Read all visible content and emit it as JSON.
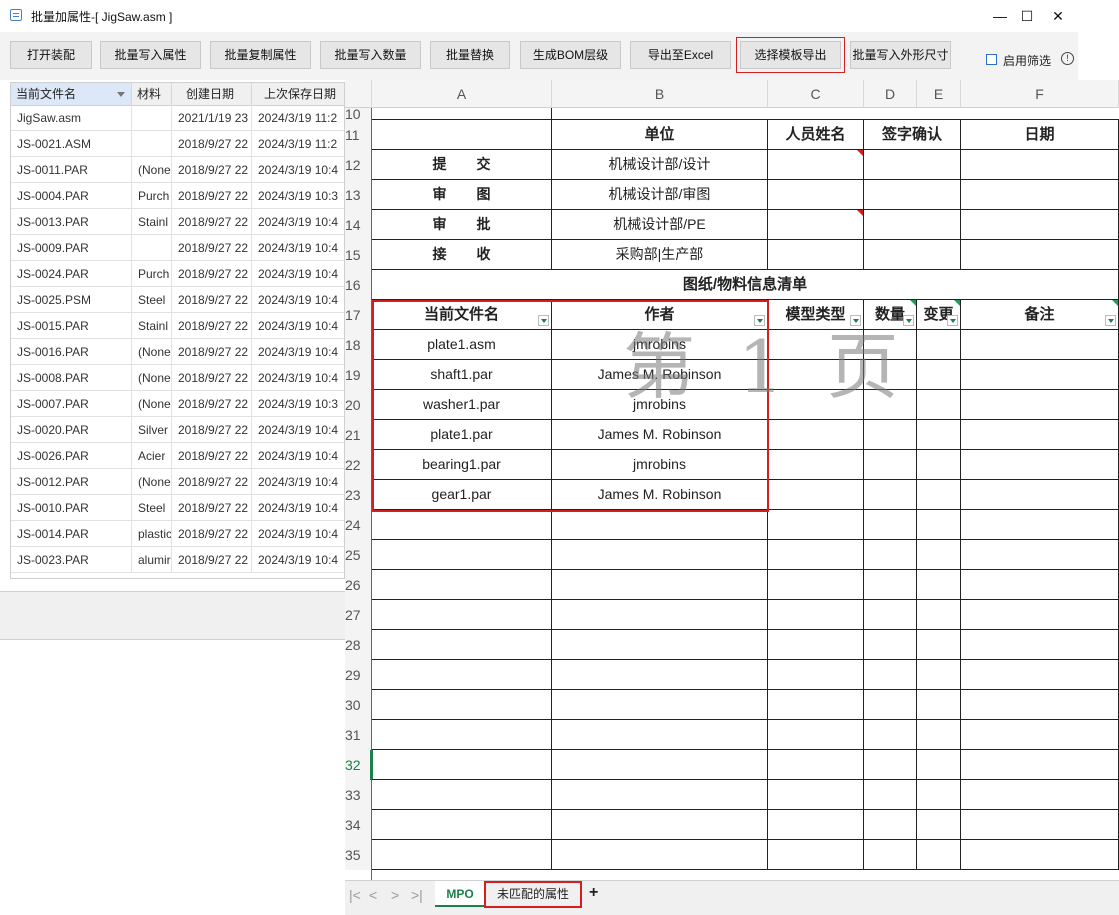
{
  "window": {
    "title": "批量加属性-[ JigSaw.asm ]",
    "minimize": "—",
    "maximize": "☐",
    "close": "✕"
  },
  "toolbar": {
    "buttons": [
      "打开装配",
      "批量写入属性",
      "批量复制属性",
      "批量写入数量",
      "批量替换",
      "生成BOM层级",
      "导出至Excel",
      "选择模板导出",
      "批量写入外形尺寸"
    ],
    "filter_label": "启用筛选",
    "info_icon": "!"
  },
  "file_list": {
    "columns": [
      "当前文件名",
      "材料",
      "创建日期",
      "上次保存日期"
    ],
    "rows": [
      [
        "JigSaw.asm",
        "",
        "2021/1/19 23",
        "2024/3/19 11:2"
      ],
      [
        "JS-0021.ASM",
        "",
        "2018/9/27 22",
        "2024/3/19 11:2"
      ],
      [
        "JS-0011.PAR",
        "(None",
        "2018/9/27 22",
        "2024/3/19 10:4"
      ],
      [
        "JS-0004.PAR",
        "Purch",
        "2018/9/27 22",
        "2024/3/19 10:3"
      ],
      [
        "JS-0013.PAR",
        "Stainl",
        "2018/9/27 22",
        "2024/3/19 10:4"
      ],
      [
        "JS-0009.PAR",
        "",
        "2018/9/27 22",
        "2024/3/19 10:4"
      ],
      [
        "JS-0024.PAR",
        "Purch",
        "2018/9/27 22",
        "2024/3/19 10:4"
      ],
      [
        "JS-0025.PSM",
        "Steel",
        "2018/9/27 22",
        "2024/3/19 10:4"
      ],
      [
        "JS-0015.PAR",
        "Stainl",
        "2018/9/27 22",
        "2024/3/19 10:4"
      ],
      [
        "JS-0016.PAR",
        "(None",
        "2018/9/27 22",
        "2024/3/19 10:4"
      ],
      [
        "JS-0008.PAR",
        "(None",
        "2018/9/27 22",
        "2024/3/19 10:4"
      ],
      [
        "JS-0007.PAR",
        "(None",
        "2018/9/27 22",
        "2024/3/19 10:3"
      ],
      [
        "JS-0020.PAR",
        "Silver",
        "2018/9/27 22",
        "2024/3/19 10:4"
      ],
      [
        "JS-0026.PAR",
        "Acier",
        "2018/9/27 22",
        "2024/3/19 10:4"
      ],
      [
        "JS-0012.PAR",
        "(None",
        "2018/9/27 22",
        "2024/3/19 10:4"
      ],
      [
        "JS-0010.PAR",
        "Steel",
        "2018/9/27 22",
        "2024/3/19 10:4"
      ],
      [
        "JS-0014.PAR",
        "plastic",
        "2018/9/27 22",
        "2024/3/19 10:4"
      ],
      [
        "JS-0023.PAR",
        "alumir",
        "2018/9/27 22",
        "2024/3/19 10:4"
      ]
    ]
  },
  "sheet": {
    "col_headers": [
      "A",
      "B",
      "C",
      "D",
      "E",
      "F"
    ],
    "row_numbers": [
      "10",
      "11",
      "12",
      "13",
      "14",
      "15",
      "16",
      "17",
      "18",
      "19",
      "20",
      "21",
      "22",
      "23",
      "24",
      "25",
      "26",
      "27",
      "28",
      "29",
      "30",
      "31",
      "32",
      "33",
      "34",
      "35"
    ],
    "header_row": [
      "",
      "单位",
      "人员姓名",
      "签字确认",
      "日期"
    ],
    "approval_rows": [
      [
        "提交",
        "机械设计部/设计"
      ],
      [
        "审图",
        "机械设计部/审图"
      ],
      [
        "审批",
        "机械设计部/PE"
      ],
      [
        "接收",
        "采购部|生产部"
      ]
    ],
    "section_title": "图纸/物料信息清单",
    "table_headers": [
      "当前文件名",
      "作者",
      "模型类型",
      "数量",
      "变更",
      "备注"
    ],
    "table_rows": [
      [
        "plate1.asm",
        "jmrobins"
      ],
      [
        "shaft1.par",
        "James M. Robinson"
      ],
      [
        "washer1.par",
        "jmrobins"
      ],
      [
        "plate1.par",
        "James M. Robinson"
      ],
      [
        "bearing1.par",
        "jmrobins"
      ],
      [
        "gear1.par",
        "James M. Robinson"
      ]
    ],
    "watermark": "第 1 页"
  },
  "tabs": {
    "nav": [
      "|<",
      "<",
      ">",
      ">|"
    ],
    "sheets": [
      "MPO",
      "未匹配的属性"
    ],
    "add": "+"
  }
}
